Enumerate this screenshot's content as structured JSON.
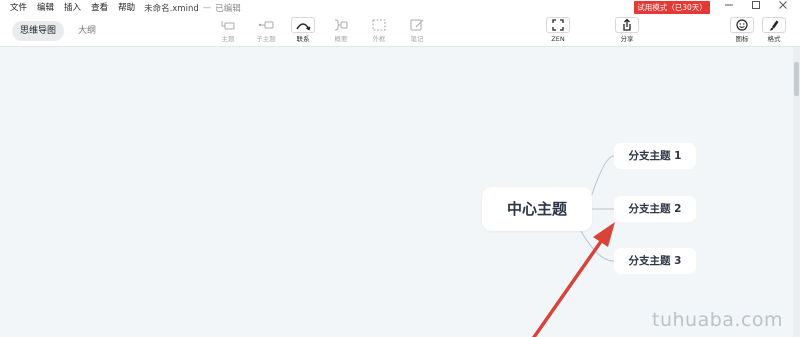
{
  "menubar": {
    "items": [
      "文件",
      "编辑",
      "插入",
      "查看",
      "帮助"
    ],
    "file_title": "未命名.xmind",
    "separator": "—",
    "file_status": "已编辑",
    "trial_badge": "试用模式（已30天）"
  },
  "window_controls": [
    "minimize-icon",
    "maximize-icon",
    "close-icon"
  ],
  "view_tabs": {
    "mindmap": "思维导图",
    "outline": "大纲"
  },
  "toolbar": {
    "topic": "主题",
    "subtopic": "子主题",
    "relationship": "联系",
    "summary": "概要",
    "boundary": "外框",
    "note": "笔记",
    "zen": "ZEN",
    "share": "分享",
    "icon": "图标",
    "format": "格式"
  },
  "mindmap": {
    "central_topic": "中心主题",
    "branches": [
      "分支主题 1",
      "分支主题 2",
      "分支主题 3"
    ]
  },
  "colors": {
    "canvas": "#f3f6f9",
    "trial_badge": "#e53935",
    "arrow": "#d9443a",
    "connector": "#b9c3cc"
  },
  "watermark": "tuhuaba.com"
}
